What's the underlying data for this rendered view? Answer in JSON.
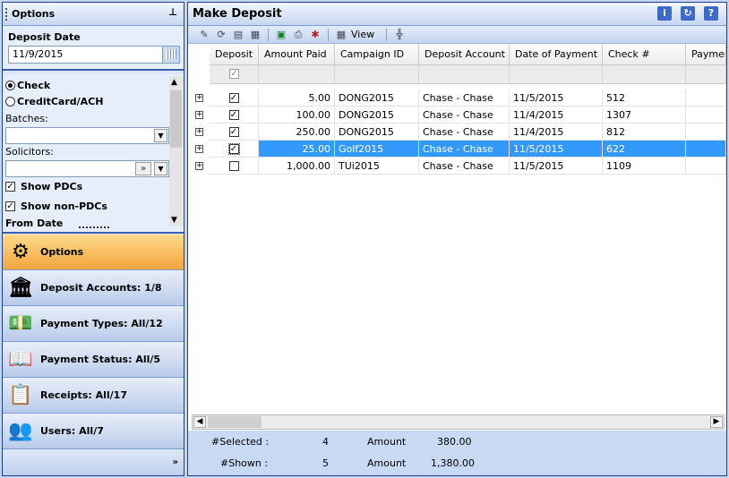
{
  "left": {
    "title": "Options",
    "pin_icon": "pin-icon",
    "deposit_date_label": "Deposit Date",
    "deposit_date_value": "11/9/2015",
    "payment_methods": [
      {
        "label": "Check",
        "selected": true
      },
      {
        "label": "CreditCard/ACH",
        "selected": false
      }
    ],
    "batches_label": "Batches:",
    "batches_value": "",
    "solicitors_label": "Solicitors:",
    "solicitors_value": "",
    "show_pdcs_label": "Show PDCs",
    "show_pdcs_checked": true,
    "show_non_pdcs_label": "Show non-PDCs",
    "show_non_pdcs_checked": true,
    "from_date_label": "From Date"
  },
  "nav": [
    {
      "label": "Options",
      "icon": "options-icon",
      "active": true
    },
    {
      "label": "Deposit Accounts: 1/8",
      "icon": "bank-icon",
      "active": false
    },
    {
      "label": "Payment Types: All/12",
      "icon": "money-icon",
      "active": false
    },
    {
      "label": "Payment Status: All/5",
      "icon": "book-icon",
      "active": false
    },
    {
      "label": "Receipts: All/17",
      "icon": "receipt-icon",
      "active": false
    },
    {
      "label": "Users: All/7",
      "icon": "users-icon",
      "active": false
    }
  ],
  "nav_more": "»",
  "main": {
    "title": "Make Deposit",
    "view_label": "View",
    "columns": [
      "Deposit",
      "Amount Paid",
      "Campaign ID",
      "Deposit Account",
      "Date of Payment",
      "Check #",
      "Payment"
    ],
    "rows": [
      {
        "deposit": true,
        "amount": "5.00",
        "campaign": "DONG2015",
        "account": "Chase - Chase",
        "date": "11/5/2015",
        "check": "512",
        "selected": false
      },
      {
        "deposit": true,
        "amount": "100.00",
        "campaign": "DONG2015",
        "account": "Chase - Chase",
        "date": "11/4/2015",
        "check": "1307",
        "selected": false
      },
      {
        "deposit": true,
        "amount": "250.00",
        "campaign": "DONG2015",
        "account": "Chase - Chase",
        "date": "11/4/2015",
        "check": "812",
        "selected": false
      },
      {
        "deposit": true,
        "amount": "25.00",
        "campaign": "Golf2015",
        "account": "Chase - Chase",
        "date": "11/5/2015",
        "check": "622",
        "selected": true
      },
      {
        "deposit": false,
        "amount": "1,000.00",
        "campaign": "TUi2015",
        "account": "Chase - Chase",
        "date": "11/5/2015",
        "check": "1109",
        "selected": false
      }
    ],
    "summary": {
      "selected_label": "#Selected :",
      "selected_count": "4",
      "selected_amount_label": "Amount",
      "selected_amount": "380.00",
      "shown_label": "#Shown :",
      "shown_count": "5",
      "shown_amount_label": "Amount",
      "shown_amount": "1,380.00"
    }
  }
}
